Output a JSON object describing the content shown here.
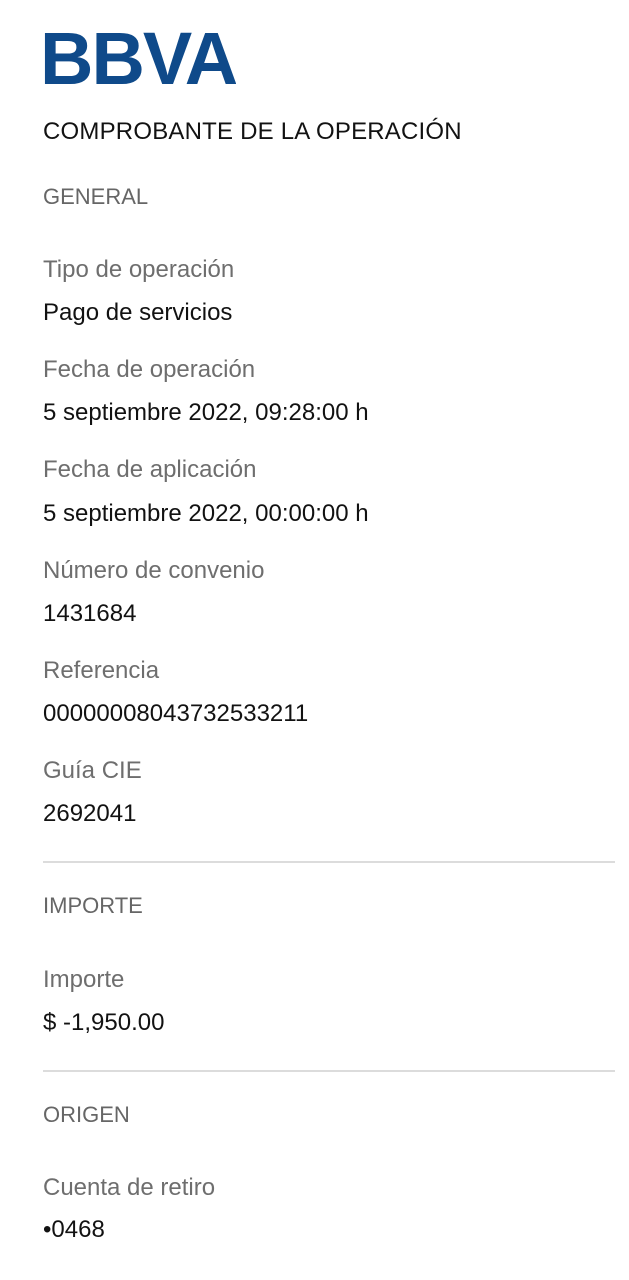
{
  "brand": {
    "logo_text": "BBVA",
    "color": "#0f4a8a"
  },
  "document": {
    "title": "COMPROBANTE DE LA OPERACIÓN"
  },
  "sections": {
    "general": {
      "title": "GENERAL",
      "fields": [
        {
          "label": "Tipo de operación",
          "value": "Pago de servicios"
        },
        {
          "label": "Fecha de operación",
          "value": "5 septiembre 2022, 09:28:00 h"
        },
        {
          "label": "Fecha de aplicación",
          "value": "5 septiembre 2022, 00:00:00 h"
        },
        {
          "label": "Número de convenio",
          "value": "1431684"
        },
        {
          "label": "Referencia",
          "value": "00000008043732533211"
        },
        {
          "label": "Guía CIE",
          "value": "2692041"
        }
      ]
    },
    "importe": {
      "title": "IMPORTE",
      "fields": [
        {
          "label": "Importe",
          "value": "$ -1,950.00"
        }
      ]
    },
    "origen": {
      "title": "ORIGEN",
      "fields": [
        {
          "label": "Cuenta de retiro",
          "value": "•0468"
        }
      ]
    }
  }
}
